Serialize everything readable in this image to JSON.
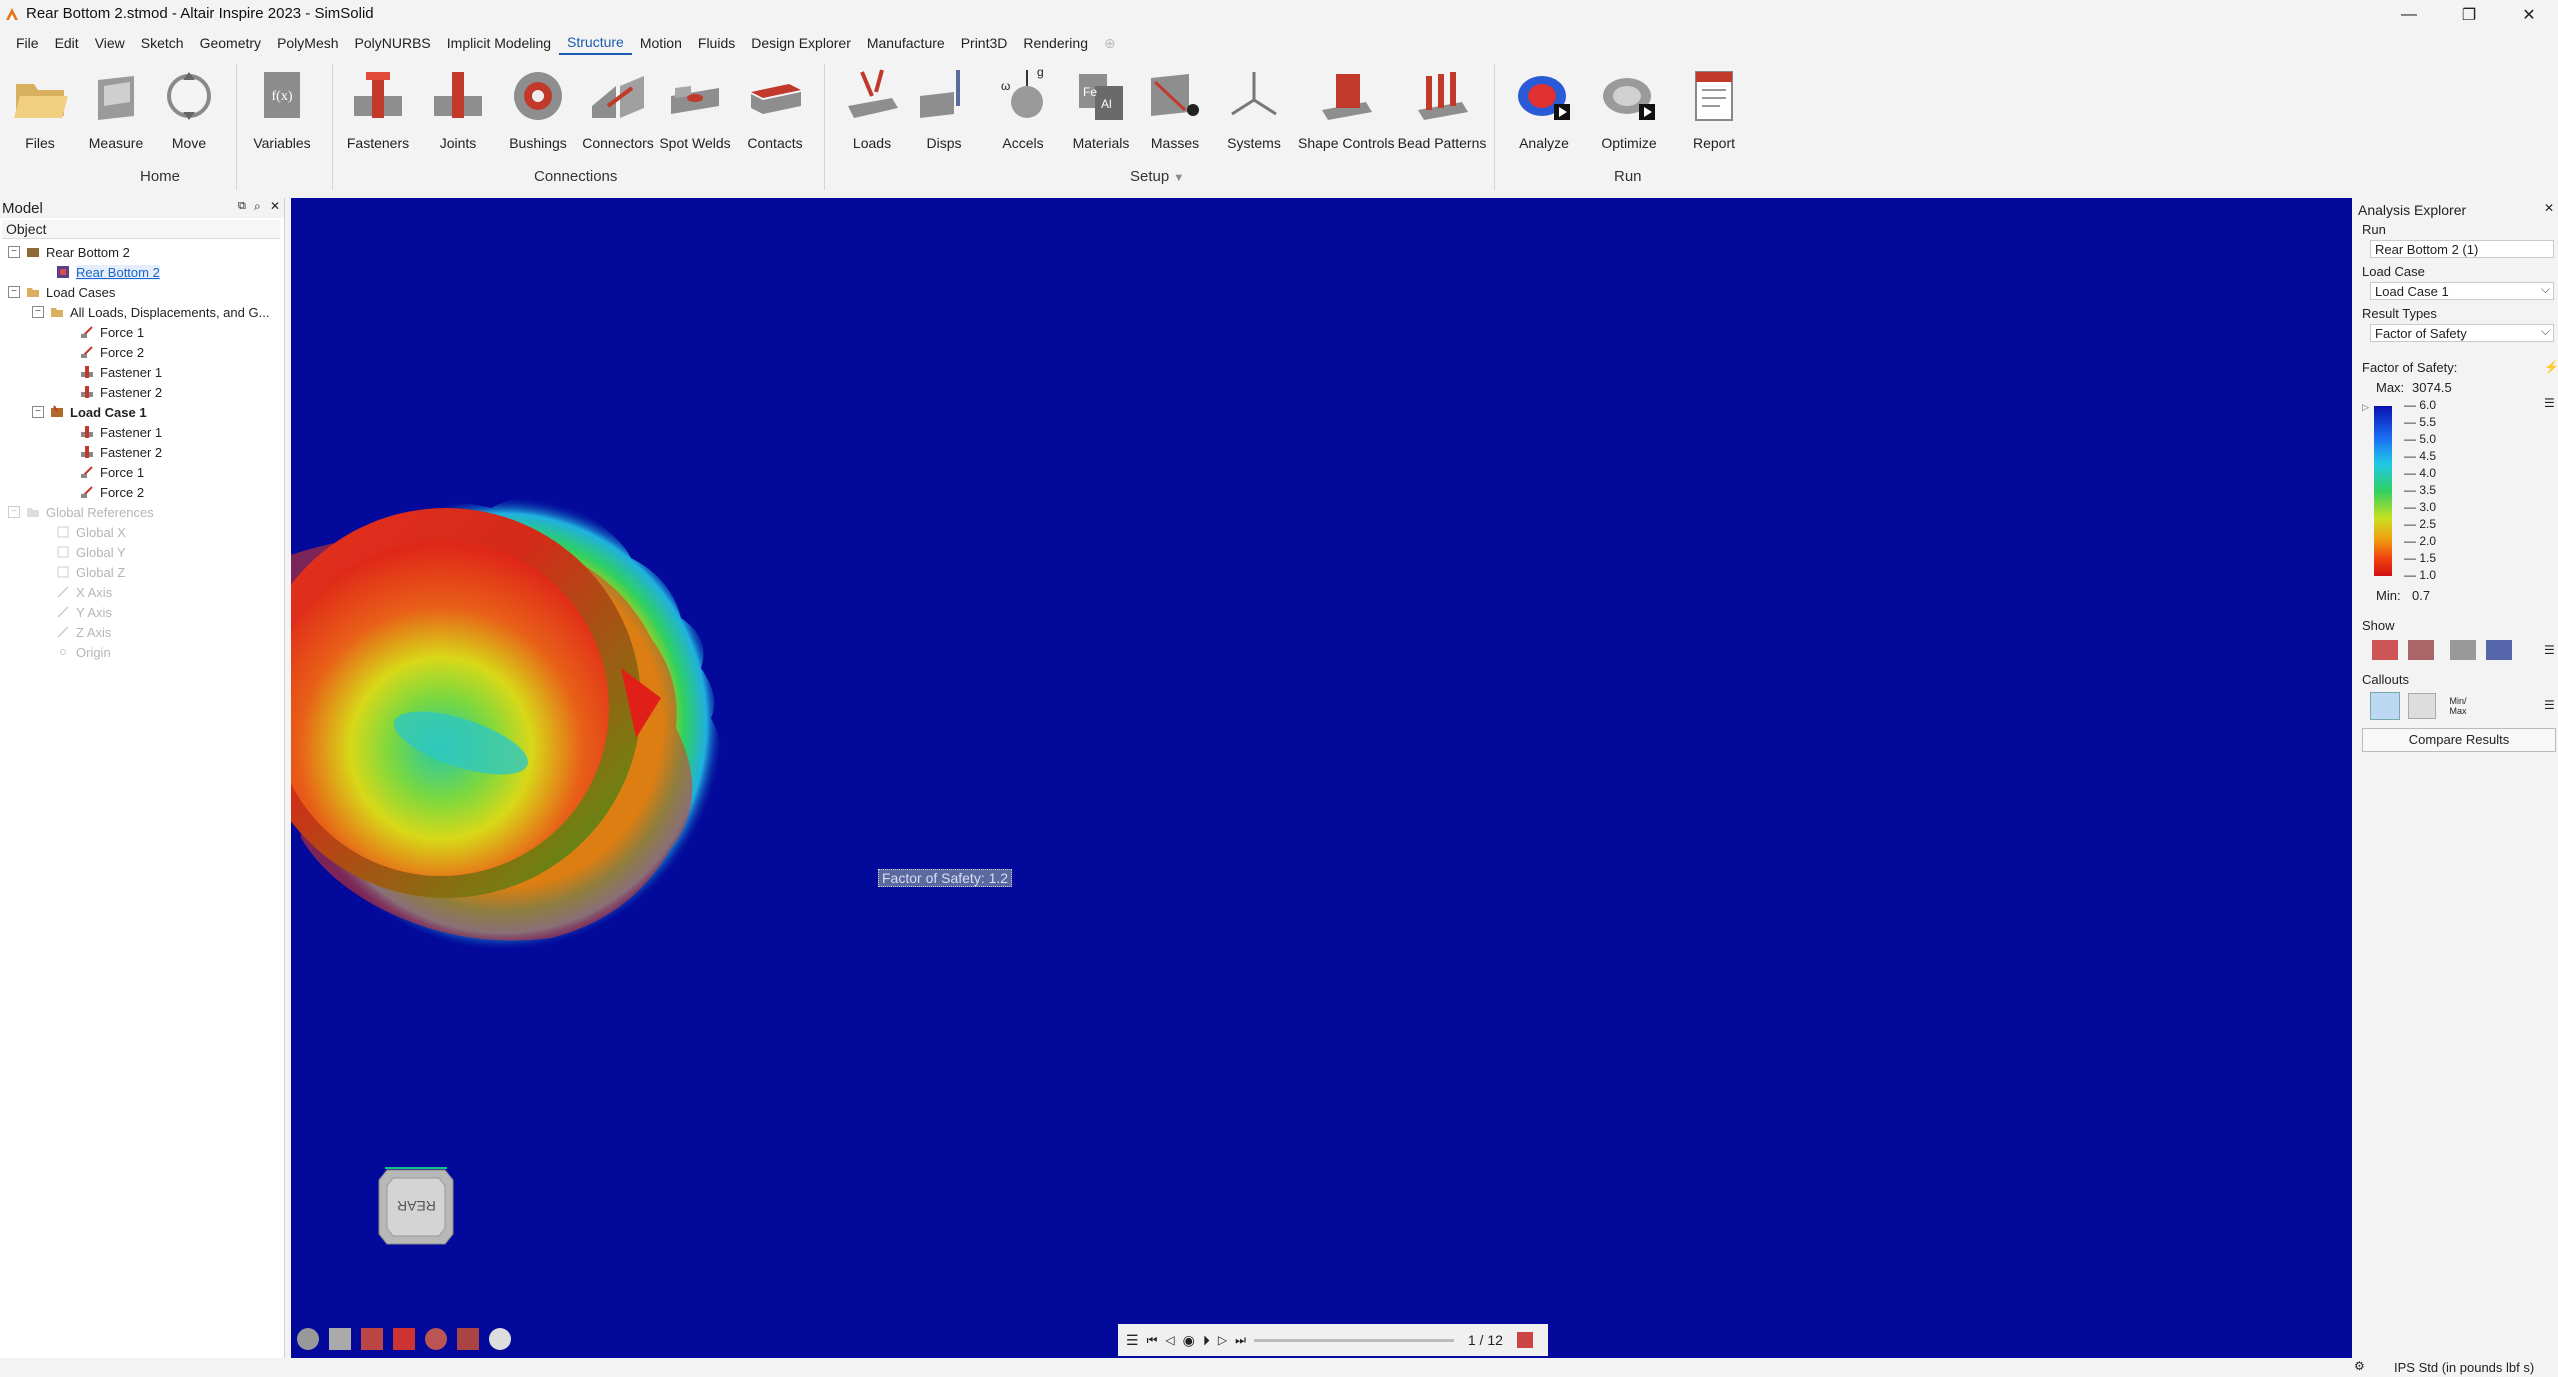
{
  "window": {
    "title": "Rear Bottom 2.stmod - Altair Inspire 2023 - SimSolid",
    "minimize": "—",
    "restore": "❐",
    "close": "✕"
  },
  "menu": [
    "File",
    "Edit",
    "View",
    "Sketch",
    "Geometry",
    "PolyMesh",
    "PolyNURBS",
    "Implicit Modeling",
    "Structure",
    "Motion",
    "Fluids",
    "Design Explorer",
    "Manufacture",
    "Print3D",
    "Rendering"
  ],
  "menu_active_index": 8,
  "ribbon": {
    "groups": {
      "home": "Home",
      "connections": "Connections",
      "setup": "Setup",
      "run": "Run"
    },
    "tools": {
      "files": "Files",
      "measure": "Measure",
      "move": "Move",
      "variables": "Variables",
      "fasteners": "Fasteners",
      "joints": "Joints",
      "bushings": "Bushings",
      "connectors": "Connectors",
      "spotwelds": "Spot Welds",
      "contacts": "Contacts",
      "loads": "Loads",
      "disps": "Disps",
      "accels": "Accels",
      "materials": "Materials",
      "masses": "Masses",
      "systems": "Systems",
      "shape_controls": "Shape Controls",
      "bead_patterns": "Bead Patterns",
      "analyze": "Analyze",
      "optimize": "Optimize",
      "report": "Report"
    }
  },
  "model_panel": {
    "title": "Model",
    "column": "Object",
    "tree": {
      "root": "Rear Bottom 2",
      "root_child": "Rear Bottom 2",
      "load_cases": "Load Cases",
      "all_loads": "All Loads, Displacements, and G...",
      "all_force1": "Force 1",
      "all_force2": "Force 2",
      "all_fastener1": "Fastener 1",
      "all_fastener2": "Fastener 2",
      "lc1": "Load Case 1",
      "lc1_fastener1": "Fastener 1",
      "lc1_fastener2": "Fastener 2",
      "lc1_force1": "Force 1",
      "lc1_force2": "Force 2",
      "global_refs": "Global References",
      "gx": "Global X",
      "gy": "Global Y",
      "gz": "Global Z",
      "xaxis": "X Axis",
      "yaxis": "Y Axis",
      "zaxis": "Z Axis",
      "origin": "Origin"
    }
  },
  "viewport": {
    "callout": "Factor of Safety: 1.2",
    "view_cube_label": "REAR",
    "frame_counter": "1 / 12"
  },
  "analysis_explorer": {
    "title": "Analysis Explorer",
    "run_label": "Run",
    "run_value": "Rear Bottom 2 (1)",
    "load_case_label": "Load Case",
    "load_case_value": "Load Case 1",
    "result_types_label": "Result Types",
    "result_type_value": "Factor of Safety",
    "legend_title": "Factor of Safety:",
    "max_label": "Max:",
    "max_value": "3074.5",
    "min_label": "Min:",
    "min_value": "0.7",
    "ticks": [
      "6.0",
      "5.5",
      "5.0",
      "4.5",
      "4.0",
      "3.5",
      "3.0",
      "2.5",
      "2.0",
      "1.5",
      "1.0"
    ],
    "show_label": "Show",
    "callouts_label": "Callouts",
    "minmax_label": "Min/ Max",
    "compare_button": "Compare Results"
  },
  "status": {
    "units": "IPS Std (in pounds lbf s)"
  }
}
